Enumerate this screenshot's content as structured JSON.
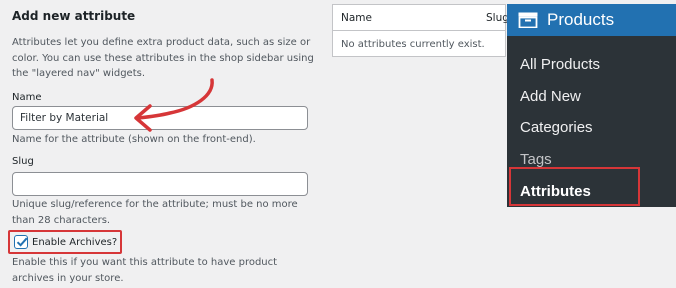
{
  "form": {
    "heading": "Add new attribute",
    "description": "Attributes let you define extra product data, such as size or color. You can use these attributes in the shop sidebar using the \"layered nav\" widgets.",
    "name_label": "Name",
    "name_value": "Filter by Material",
    "name_hint": "Name for the attribute (shown on the front-end).",
    "slug_label": "Slug",
    "slug_value": "",
    "slug_hint": "Unique slug/reference for the attribute; must be no more than 28 characters.",
    "archives_label": "Enable Archives?",
    "archives_checked": true,
    "archives_hint": "Enable this if you want this attribute to have product archives in your store."
  },
  "table": {
    "columns": [
      "Name",
      "Slug"
    ],
    "empty_message": "No attributes currently exist."
  },
  "menu": {
    "title": "Products",
    "items": [
      {
        "label": "All Products"
      },
      {
        "label": "Add New"
      },
      {
        "label": "Categories"
      },
      {
        "label": "Tags"
      },
      {
        "label": "Attributes"
      }
    ]
  },
  "colors": {
    "annotation": "#d63638",
    "menu_header": "#2271b1",
    "menu_background": "#2c3338",
    "page_background": "#f0f0f1"
  }
}
